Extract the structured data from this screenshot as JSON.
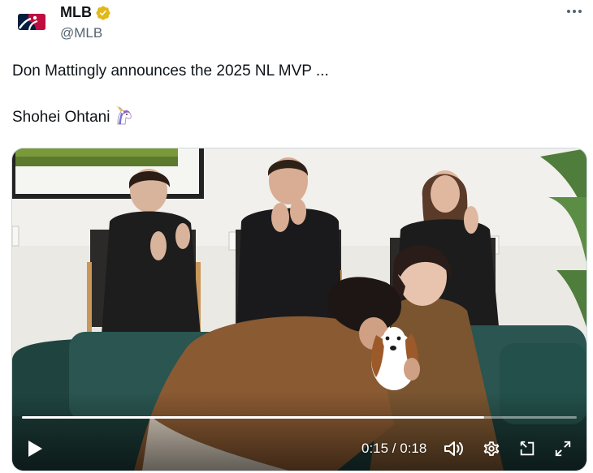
{
  "author": {
    "display_name": "MLB",
    "handle": "@MLB",
    "verified": true,
    "avatar_icon": "mlb-logo",
    "verified_badge_color": "#e2b719"
  },
  "menu_icon": "more-horizontal-icon",
  "tweet": {
    "line1": "Don Mattingly announces the 2025 NL MVP ...",
    "line2": "Shohei Ohtani",
    "emoji_icon": "unicorn-emoji"
  },
  "video": {
    "current_time": "0:15",
    "duration": "0:18",
    "time_display": "0:15 / 0:18",
    "progress_fraction": 0.833,
    "controls": [
      "play-icon",
      "volume-icon",
      "settings-icon",
      "dock-icon",
      "fullscreen-icon"
    ]
  }
}
